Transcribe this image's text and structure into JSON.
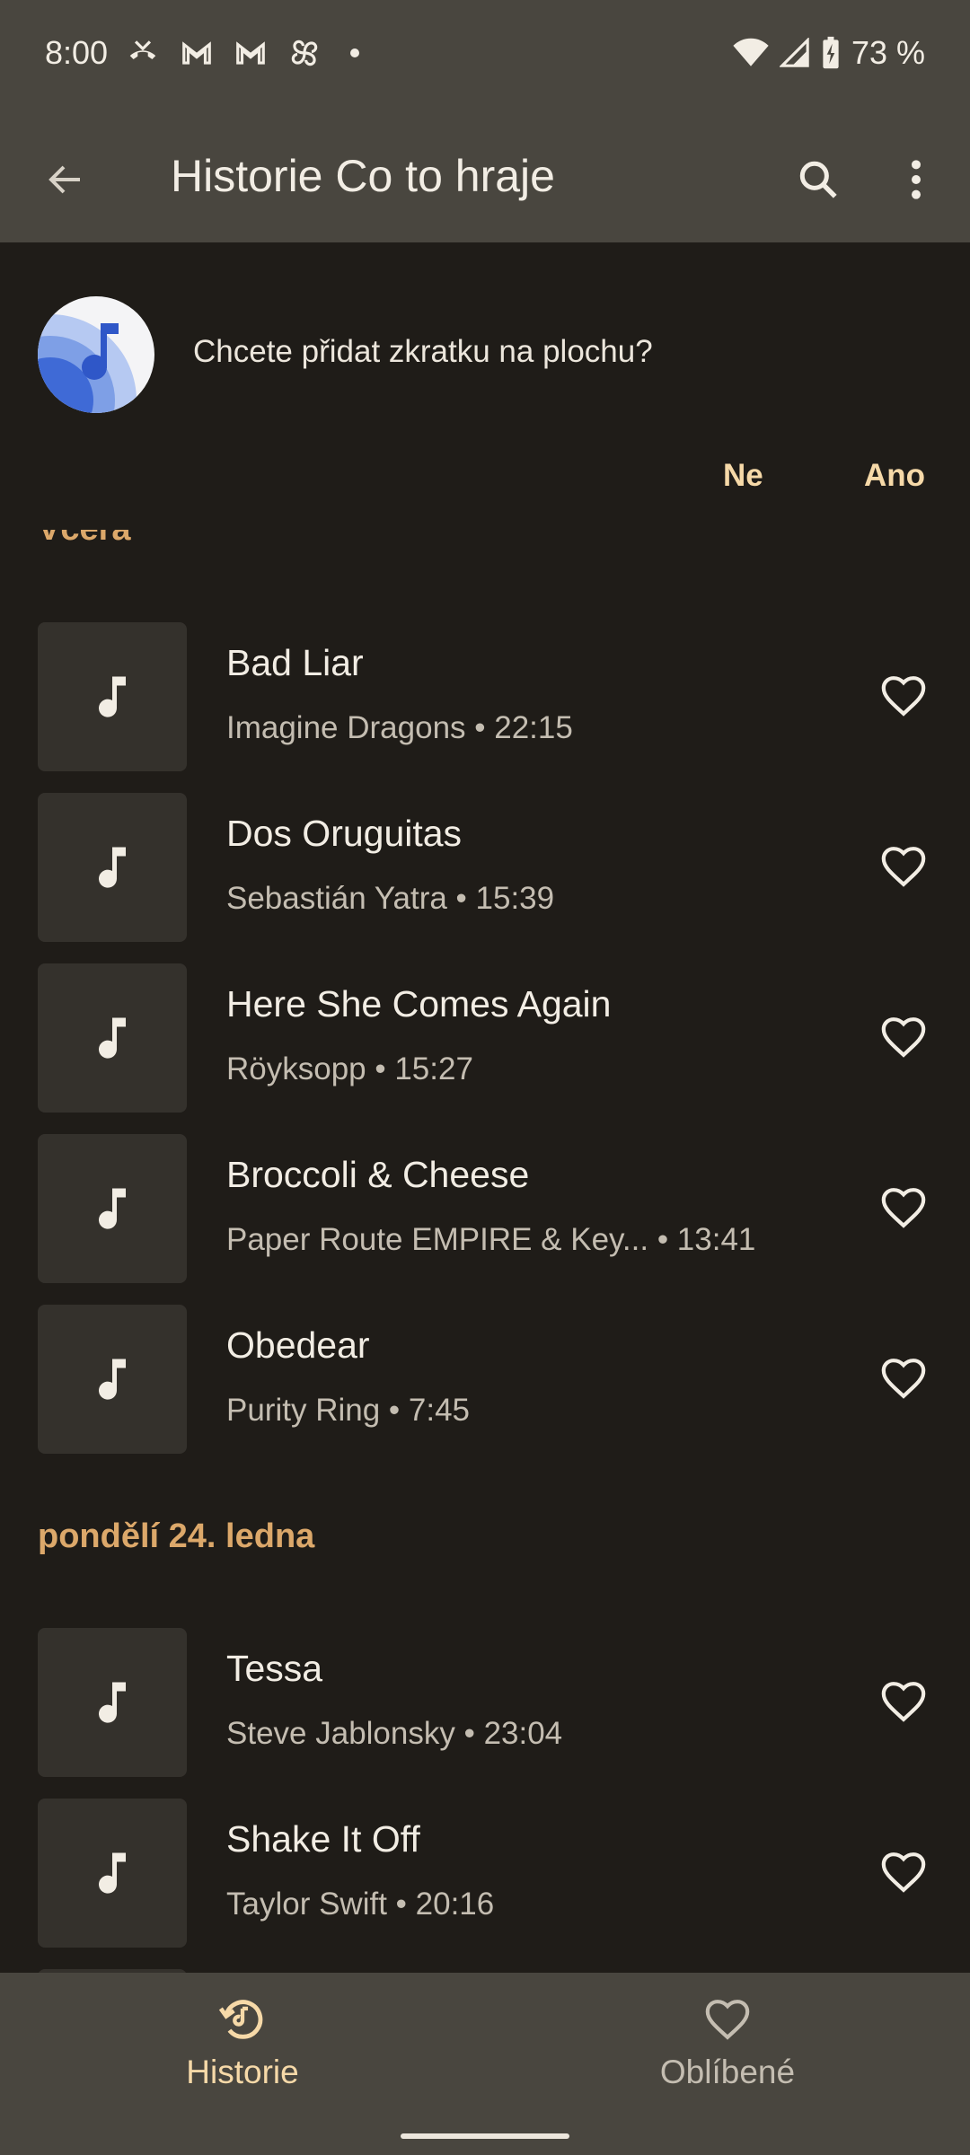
{
  "status_bar": {
    "time": "8:00",
    "battery": "73 %",
    "icons": [
      "missed-call-icon",
      "gmail-icon",
      "gmail-icon",
      "pinwheel-icon",
      "dot-icon",
      "wifi-icon",
      "signal-icon",
      "battery-charging-icon"
    ]
  },
  "app_bar": {
    "title": "Historie Co to hraje",
    "icons": [
      "back-arrow-icon",
      "search-icon",
      "more-vert-icon"
    ]
  },
  "shortcut_banner": {
    "text": "Chcete přidat zkratku na plochu?",
    "no_label": "Ne",
    "yes_label": "Ano",
    "icon": "now-playing-logo-icon"
  },
  "sections": [
    {
      "header": "Včera",
      "songs": [
        {
          "title": "Bad Liar",
          "subtitle": "Imagine Dragons • 22:15"
        },
        {
          "title": "Dos Oruguitas",
          "subtitle": "Sebastián Yatra • 15:39"
        },
        {
          "title": "Here She Comes Again",
          "subtitle": "Röyksopp • 15:27"
        },
        {
          "title": "Broccoli & Cheese",
          "subtitle": "Paper Route EMPIRE & Key... • 13:41"
        },
        {
          "title": "Obedear",
          "subtitle": "Purity Ring • 7:45"
        }
      ]
    },
    {
      "header": "pondělí 24. ledna",
      "songs": [
        {
          "title": "Tessa",
          "subtitle": "Steve Jablonsky • 23:04"
        },
        {
          "title": "Shake It Off",
          "subtitle": "Taylor Swift • 20:16"
        }
      ]
    }
  ],
  "bottom_nav": {
    "history_label": "Historie",
    "favorites_label": "Oblíbené",
    "active": "history"
  },
  "colors": {
    "background": "#1f1c18",
    "chrome": "#49463f",
    "accent": "#f6d9a8",
    "section_header": "#dca86a",
    "thumb": "#34312c"
  }
}
